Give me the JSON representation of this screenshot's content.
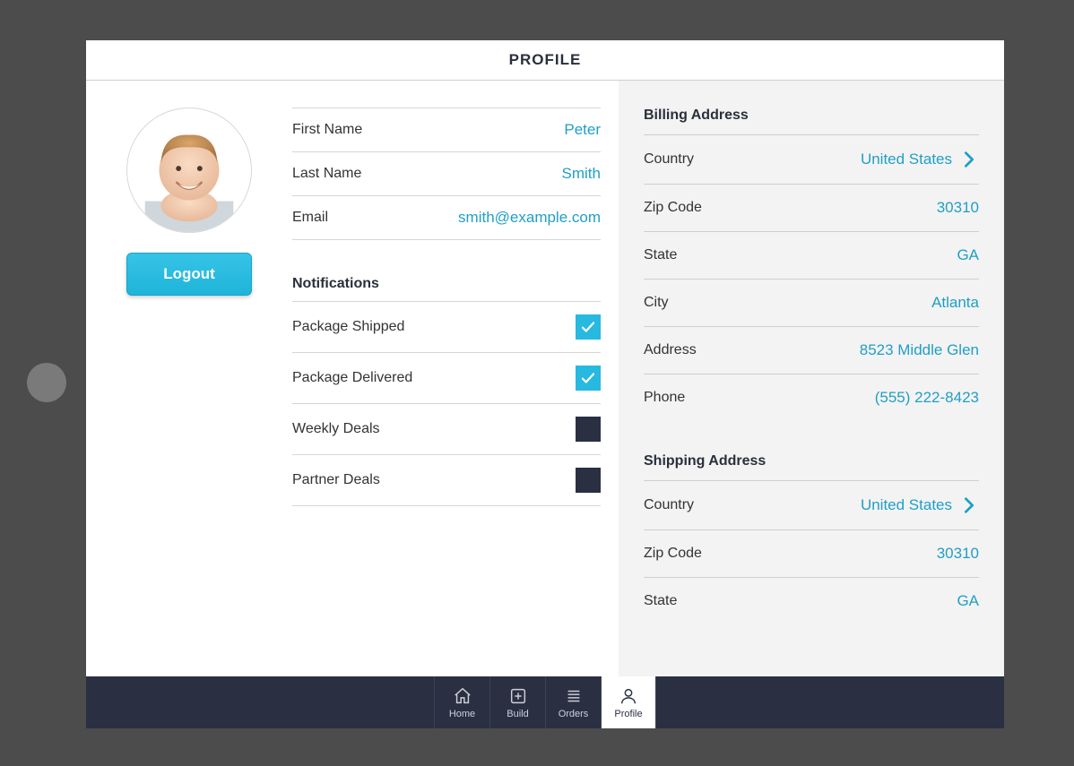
{
  "header": {
    "title": "PROFILE"
  },
  "logout_label": "Logout",
  "fields": {
    "first_name": {
      "label": "First Name",
      "value": "Peter"
    },
    "last_name": {
      "label": "Last Name",
      "value": "Smith"
    },
    "email": {
      "label": "Email",
      "value": "smith@example.com"
    }
  },
  "notifications": {
    "title": "Notifications",
    "items": [
      {
        "label": "Package Shipped",
        "checked": true
      },
      {
        "label": "Package Delivered",
        "checked": true
      },
      {
        "label": "Weekly Deals",
        "checked": false
      },
      {
        "label": "Partner Deals",
        "checked": false
      }
    ]
  },
  "billing": {
    "title": "Billing Address",
    "rows": [
      {
        "label": "Country",
        "value": "United States",
        "chevron": true
      },
      {
        "label": "Zip Code",
        "value": "30310"
      },
      {
        "label": "State",
        "value": "GA"
      },
      {
        "label": "City",
        "value": "Atlanta"
      },
      {
        "label": "Address",
        "value": "8523 Middle Glen"
      },
      {
        "label": "Phone",
        "value": "(555) 222-8423"
      }
    ]
  },
  "shipping": {
    "title": "Shipping Address",
    "rows": [
      {
        "label": "Country",
        "value": "United States",
        "chevron": true
      },
      {
        "label": "Zip Code",
        "value": "30310"
      },
      {
        "label": "State",
        "value": "GA"
      }
    ]
  },
  "tabs": [
    {
      "id": "home",
      "label": "Home",
      "active": false
    },
    {
      "id": "build",
      "label": "Build",
      "active": false
    },
    {
      "id": "orders",
      "label": "Orders",
      "active": false
    },
    {
      "id": "profile",
      "label": "Profile",
      "active": true
    }
  ]
}
